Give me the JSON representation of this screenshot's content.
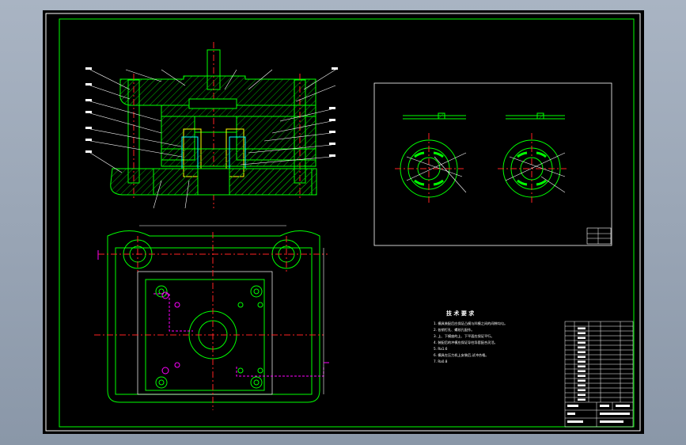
{
  "colors": {
    "frame": "#ffffff",
    "part": "#00ff00",
    "hatch": "#00cc00",
    "center": "#ff2020",
    "dim": "#ffffff",
    "hidden": "#ff00ff",
    "yellow": "#ffff00",
    "cyan": "#00ffff"
  },
  "notes": {
    "heading": "技 术 要 求",
    "lines": [
      "1. 模具装配后应保证凸模与凹模之间的间隙均匀。",
      "2. 各销钉孔、螺纹孔配作。",
      "3. 上、下模座的上、下平面应保证平行。",
      "4. 装配后的冲模应保证导柱导套配合灵活。",
      "5. Ra1.6",
      "6. 模具在压力机上安装后,试冲合格。",
      "7. Ra0.8"
    ]
  }
}
